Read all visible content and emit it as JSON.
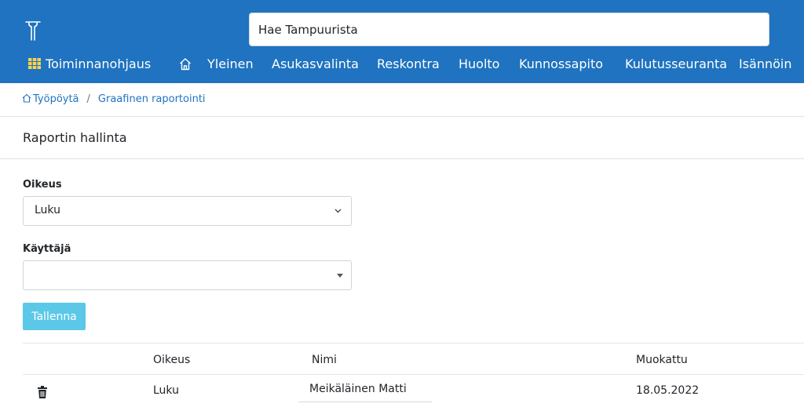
{
  "header": {
    "search_placeholder": "Hae Tampuurista"
  },
  "nav": {
    "items": [
      {
        "label": "Toiminnanohjaus",
        "icon": "grid-icon"
      },
      {
        "label": "",
        "icon": "home-icon"
      },
      {
        "label": "Yleinen"
      },
      {
        "label": "Asukasvalinta"
      },
      {
        "label": "Reskontra"
      },
      {
        "label": "Huolto"
      },
      {
        "label": "Kunnossapito"
      },
      {
        "label": "Kulutusseuranta"
      },
      {
        "label": "Isännöin"
      }
    ]
  },
  "breadcrumb": {
    "home": "Työpöytä",
    "separator": "/",
    "current": "Graafinen raportointi"
  },
  "section": {
    "title": "Raportin hallinta"
  },
  "form": {
    "oikeus_label": "Oikeus",
    "oikeus_value": "Luku",
    "kayttaja_label": "Käyttäjä",
    "kayttaja_value": "",
    "save_label": "Tallenna"
  },
  "table": {
    "headers": [
      "Oikeus",
      "Nimi",
      "Muokattu"
    ],
    "rows": [
      {
        "oikeus": "Luku",
        "nimi": "Meikäläinen Matti",
        "muokattu": "18.05.2022"
      }
    ]
  },
  "colors": {
    "brand": "#1f73c0",
    "save_button": "#5bc8e8",
    "link": "#1f73c0"
  }
}
